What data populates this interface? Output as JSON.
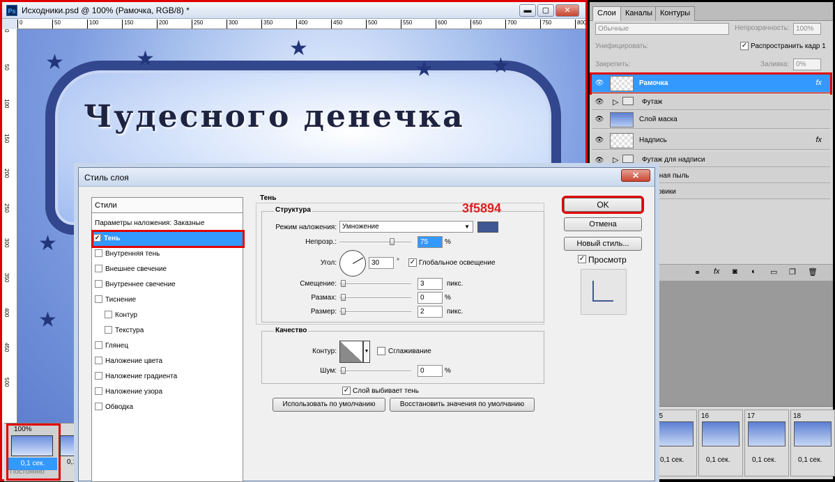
{
  "doc": {
    "title": "Исходники.psd @ 100% (Рамочка, RGB/8) *",
    "min_label": "▬",
    "max_label": "▢",
    "close_label": "✕",
    "ruler_top": [
      "0",
      "50",
      "100",
      "150",
      "200",
      "250",
      "300",
      "350",
      "400",
      "450",
      "500",
      "550",
      "600",
      "650",
      "700",
      "750",
      "800"
    ],
    "ruler_left": [
      "0",
      "50",
      "100",
      "150",
      "200",
      "250",
      "300",
      "350",
      "400",
      "450",
      "500"
    ],
    "canvas_text": "Чудесного денечка",
    "zoom": "100%",
    "frame1_delay": "0,1 сек.",
    "frame2_delay": "0,1",
    "loop": "Постоянно"
  },
  "layers_panel": {
    "tabs": [
      "Слои",
      "Каналы",
      "Контуры"
    ],
    "blend_mode": "Обычные",
    "opacity_label": "Непрозрачность:",
    "opacity_value": "100%",
    "unify_label": "Унифицировать:",
    "propagate_label": "Распространить кадр 1",
    "lock_label": "Закрепить:",
    "fill_label": "Заливка:",
    "fill_value": "0%",
    "layers": [
      {
        "name": "Рамочка",
        "fx": "fx"
      },
      {
        "name": "Футаж"
      },
      {
        "name": "Слой маска"
      },
      {
        "name": "Надпись",
        "fx": "fx"
      },
      {
        "name": "Футаж для надписи"
      },
      {
        "name": "жная пыль"
      },
      {
        "name": "товики"
      }
    ]
  },
  "timeline": {
    "frames": [
      {
        "num": "15",
        "delay": "0,1 сек."
      },
      {
        "num": "16",
        "delay": "0,1 сек."
      },
      {
        "num": "17",
        "delay": "0,1 сек."
      },
      {
        "num": "18",
        "delay": "0,1 сек."
      }
    ]
  },
  "dialog": {
    "title": "Стиль слоя",
    "close_label": "✕",
    "styles_header": "Стили",
    "blend_options": "Параметры наложения: Заказные",
    "items": [
      "Тень",
      "Внутренняя тень",
      "Внешнее свечение",
      "Внутреннее свечение",
      "Тиснение",
      "Контур",
      "Текстура",
      "Глянец",
      "Наложение цвета",
      "Наложение градиента",
      "Наложение узора",
      "Обводка"
    ],
    "section_title": "Тень",
    "structure_title": "Структура",
    "blend_mode_label": "Режим наложения:",
    "blend_mode_value": "Умножение",
    "shadow_color": "#3f5894",
    "color_hex_note": "3f5894",
    "opacity_label": "Непрозр.:",
    "opacity_value": "75",
    "percent": "%",
    "angle_label": "Угол:",
    "angle_value": "30",
    "degree": "°",
    "global_light": "Глобальное освещение",
    "distance_label": "Смещение:",
    "distance_value": "3",
    "px": "пикс.",
    "spread_label": "Размах:",
    "spread_value": "0",
    "size_label": "Размер:",
    "size_value": "2",
    "quality_title": "Качество",
    "contour_label": "Контур:",
    "antialias": "Сглаживание",
    "noise_label": "Шум:",
    "noise_value": "0",
    "knockout": "Слой выбивает тень",
    "default_btn": "Использовать по умолчанию",
    "reset_btn": "Восстановить значения по умолчанию",
    "ok": "OK",
    "cancel": "Отмена",
    "new_style": "Новый стиль...",
    "preview": "Просмотр"
  }
}
